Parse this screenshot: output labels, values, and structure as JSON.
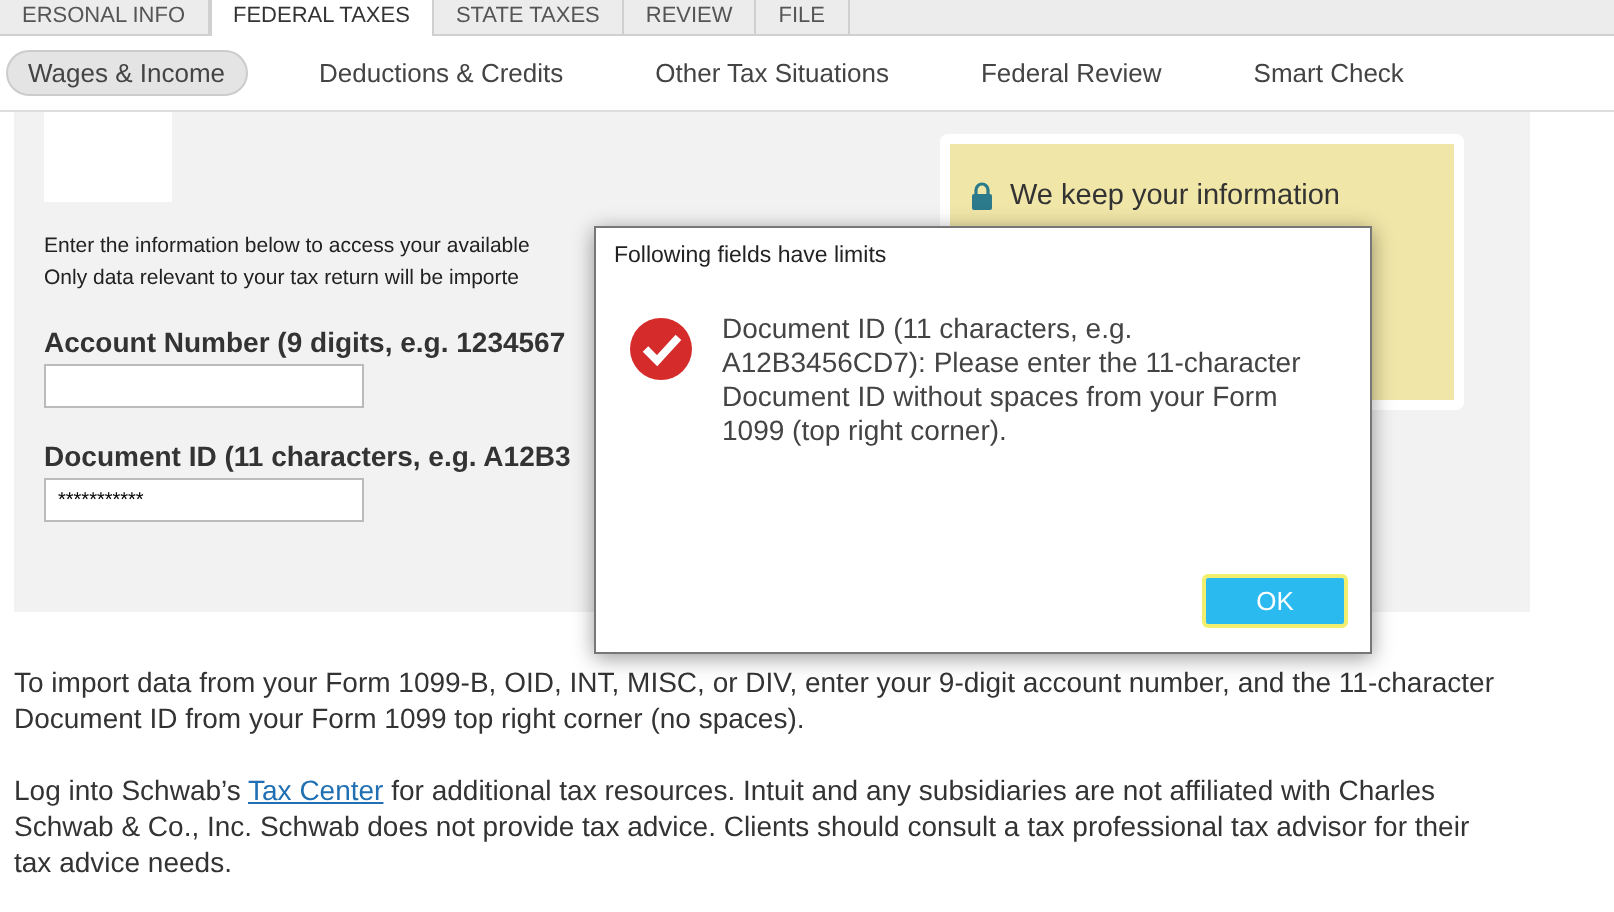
{
  "top_tabs": [
    {
      "label": "ERSONAL INFO",
      "selected": false
    },
    {
      "label": "FEDERAL TAXES",
      "selected": true
    },
    {
      "label": "STATE TAXES",
      "selected": false
    },
    {
      "label": "REVIEW",
      "selected": false
    },
    {
      "label": "FILE",
      "selected": false
    }
  ],
  "sub_tabs": [
    {
      "label": "Wages & Income",
      "selected": true
    },
    {
      "label": "Deductions & Credits",
      "selected": false
    },
    {
      "label": "Other Tax Situations",
      "selected": false
    },
    {
      "label": "Federal Review",
      "selected": false
    },
    {
      "label": "Smart Check",
      "selected": false
    }
  ],
  "form": {
    "intro": [
      "Enter the information below to access your available",
      "Only data relevant to your tax return will be importe"
    ],
    "fields": [
      {
        "label": "Account Number (9 digits, e.g. 1234567"
      },
      {
        "label": "Document ID (11 characters, e.g. A12B3",
        "value": "***********"
      }
    ]
  },
  "security_note": {
    "text": "We keep your information"
  },
  "footer": {
    "import_note": "To import data from your Form 1099-B, OID, INT, MISC, or DIV, enter your 9-digit account number, and the 11-character Document ID from your Form 1099 top right corner (no spaces).",
    "disclaimer_before": "Log into Schwab’s ",
    "link": "Tax Center",
    "disclaimer_after": " for additional tax resources. Intuit and any subsidiaries are not affiliated with Charles Schwab & Co., Inc. Schwab does not provide tax advice.  Clients should consult a tax professional tax advisor for their tax advice needs."
  },
  "dialog": {
    "title": "Following fields have limits",
    "message": "Document ID (11 characters, e.g. A12B3456CD7): Please enter the 11-character Document ID without spaces from your Form 1099 (top right corner).",
    "button": "OK"
  }
}
